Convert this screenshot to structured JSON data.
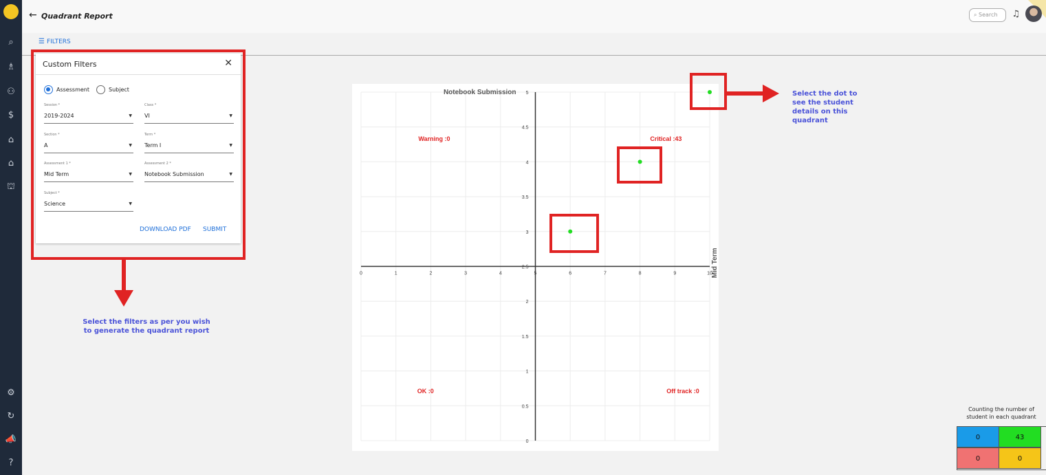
{
  "app": {
    "title": "Quadrant Report",
    "search_placeholder": "Search",
    "filters_label": "FILTERS"
  },
  "sidebar": {
    "icons": [
      "logo-icon",
      "search-icon",
      "academic-icon",
      "users-icon",
      "dollar-icon",
      "building-icon",
      "home-icon",
      "institution-icon",
      "settings-icon",
      "sync-icon",
      "megaphone-icon",
      "help-icon"
    ],
    "notification_count": "0"
  },
  "filters_panel": {
    "title": "Custom Filters",
    "radios": [
      {
        "label": "Assessment",
        "selected": true
      },
      {
        "label": "Subject",
        "selected": false
      }
    ],
    "fields": [
      {
        "label": "Session *",
        "value": "2019-2024"
      },
      {
        "label": "Class *",
        "value": "VI"
      },
      {
        "label": "Section *",
        "value": "A"
      },
      {
        "label": "Term *",
        "value": "Term I"
      },
      {
        "label": "Assessment 1 *",
        "value": "Mid Term"
      },
      {
        "label": "Assessment 2 *",
        "value": "Notebook Submission"
      },
      {
        "label": "Subject *",
        "value": "Science"
      }
    ],
    "download_label": "DOWNLOAD PDF",
    "submit_label": "SUBMIT"
  },
  "annotations": {
    "filters_hint": "Select the filters as per you wish\nto generate the quadrant report",
    "dot_hint": "Select the dot to\nsee the student\ndetails on this\nquadrant"
  },
  "chart_data": {
    "type": "scatter",
    "title": "Notebook Submission",
    "xlabel": "Mid Term",
    "ylabel": "Notebook Submission",
    "xlim": [
      0,
      10
    ],
    "ylim": [
      0,
      5
    ],
    "x_ticks": [
      "0",
      "1",
      "2",
      "3",
      "4",
      "5",
      "6",
      "7",
      "8",
      "9",
      "10"
    ],
    "y_ticks": [
      "0",
      "0.5",
      "1",
      "1.5",
      "2",
      "2.5",
      "3",
      "3.5",
      "4",
      "4.5",
      "5"
    ],
    "x_axis_at_y": 2.5,
    "y_axis_at_x": 5,
    "grid": true,
    "point_color": "#22dd22",
    "points": [
      {
        "x": 6,
        "y": 3
      },
      {
        "x": 8,
        "y": 4
      },
      {
        "x": 10,
        "y": 5
      }
    ],
    "quadrant_labels": [
      {
        "text": "Warning :0",
        "position": "top-left"
      },
      {
        "text": "Critical :43",
        "position": "top-right"
      },
      {
        "text": "OK :0",
        "position": "bottom-left"
      },
      {
        "text": "Off track :0",
        "position": "bottom-right"
      }
    ]
  },
  "quadrant_counts": {
    "caption": "Counting the number of\nstudent in each quadrant",
    "cells": [
      {
        "value": "0",
        "color": "#1a9be8"
      },
      {
        "value": "43",
        "color": "#22dd22"
      },
      {
        "value": "0",
        "color": "#f07272"
      },
      {
        "value": "0",
        "color": "#f5c518"
      }
    ]
  },
  "colors": {
    "accent": "#1e6fd9",
    "annotation_red": "#e02323",
    "annotation_text": "#4a52d8",
    "quadrant_label": "#e02323"
  }
}
